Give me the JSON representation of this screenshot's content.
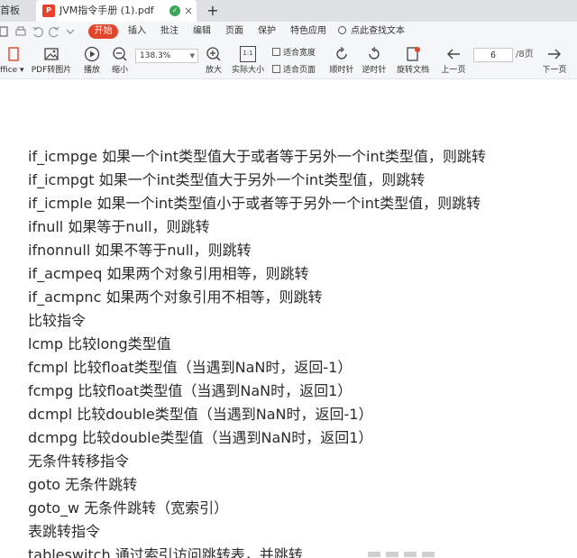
{
  "tabs": {
    "prev_label": "首板",
    "active_label": "JVM指令手册 (1).pdf",
    "pdf_badge": "P",
    "add": "+",
    "close": "×",
    "status": "✓"
  },
  "menu": {
    "start": "开始",
    "items": [
      "插入",
      "批注",
      "编辑",
      "页面",
      "保护",
      "特色应用"
    ],
    "search": "点此查找文本"
  },
  "toolbar": {
    "office_label": "ffice ▾",
    "pdf_to_image": "PDF转图片",
    "play": "播放",
    "zoom_out": "缩小",
    "zoom_value": "138.3%",
    "zoom_in": "放大",
    "actual_size": "实际大小",
    "fit_width": "适合宽度",
    "fit_page": "适合页面",
    "rotate_cw": "顺时针",
    "rotate_ccw": "逆时针",
    "rotate_doc": "旋转文档",
    "prev_page": "上一页",
    "page_current": "6",
    "page_total": "/8页",
    "next_page": "下一页",
    "actual_icon_text": "1:1"
  },
  "document": {
    "lines": [
      "if_icmpge 如果一个int类型值大于或者等于另外一个int类型值，则跳转",
      "if_icmpgt 如果一个int类型值大于另外一个int类型值，则跳转",
      "if_icmple 如果一个int类型值小于或者等于另外一个int类型值，则跳转",
      "ifnull 如果等于null，则跳转",
      "ifnonnull 如果不等于null，则跳转",
      "if_acmpeq 如果两个对象引用相等，则跳转",
      "if_acmpnc 如果两个对象引用不相等，则跳转",
      "比较指令",
      "lcmp 比较long类型值",
      "fcmpl 比较float类型值（当遇到NaN时，返回-1）",
      "fcmpg 比较float类型值（当遇到NaN时，返回1）",
      "dcmpl 比较double类型值（当遇到NaN时，返回-1）",
      "dcmpg 比较double类型值（当遇到NaN时，返回1）",
      "无条件转移指令",
      "goto 无条件跳转",
      "goto_w 无条件跳转（宽索引）",
      "表跳转指令",
      "tableswitch 通过索引访问跳转表，并跳转"
    ]
  }
}
